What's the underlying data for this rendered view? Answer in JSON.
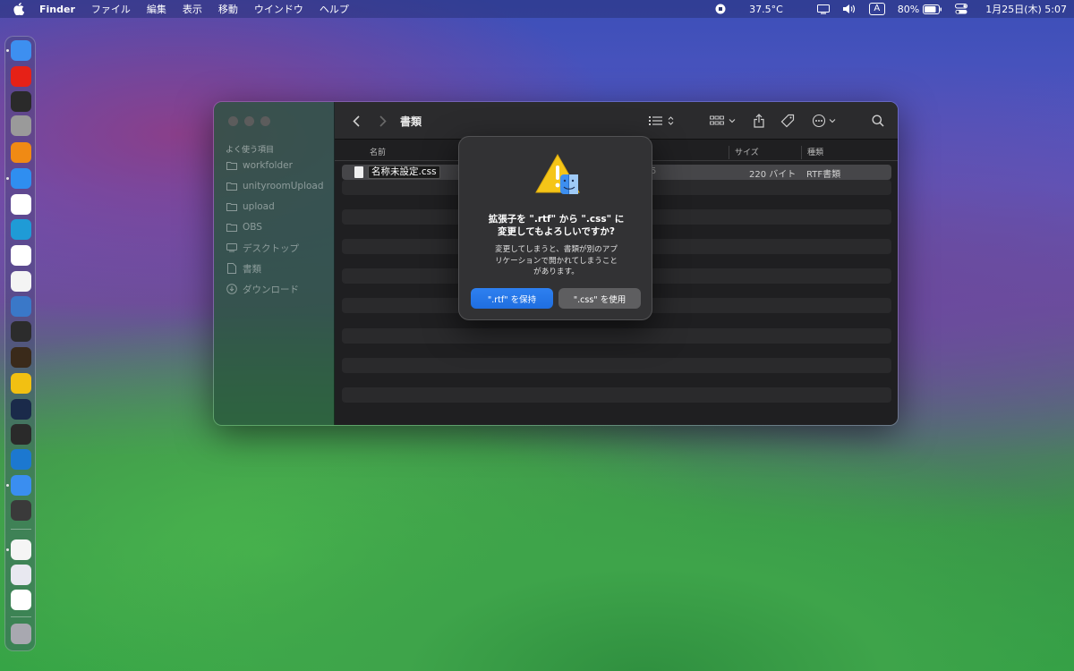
{
  "menubar": {
    "app_name": "Finder",
    "items": [
      "ファイル",
      "編集",
      "表示",
      "移動",
      "ウインドウ",
      "ヘルプ"
    ],
    "temperature": "37.5°C",
    "ime": "A",
    "battery": "80%",
    "datetime": "1月25日(木) 5:07"
  },
  "dock": {
    "apps": [
      {
        "name": "finder-icon",
        "color": "#3d8ff0"
      },
      {
        "name": "youtube-icon",
        "color": "#e62117"
      },
      {
        "name": "obs-icon",
        "color": "#2a2a2a"
      },
      {
        "name": "webcam-icon",
        "color": "#9a9a9a"
      },
      {
        "name": "vlc-icon",
        "color": "#f08a14"
      },
      {
        "name": "safari-icon",
        "color": "#2f8ef0"
      },
      {
        "name": "chrome-icon",
        "color": "#ffffff"
      },
      {
        "name": "edge-icon",
        "color": "#1f9bd6"
      },
      {
        "name": "activity-monitor-icon",
        "color": "#ffffff"
      },
      {
        "name": "textedit-icon",
        "color": "#f4f4f4"
      },
      {
        "name": "quicktime-icon",
        "color": "#3a78c8"
      },
      {
        "name": "final-cut-icon",
        "color": "#2c2c2c"
      },
      {
        "name": "garageband-icon",
        "color": "#3a2a1a"
      },
      {
        "name": "vectorworks-icon",
        "color": "#f2c012"
      },
      {
        "name": "blender-icon",
        "color": "#1a2a4a"
      },
      {
        "name": "unity-icon",
        "color": "#2a2a2a"
      },
      {
        "name": "vscode-icon",
        "color": "#1c78d0"
      },
      {
        "name": "xcode-icon",
        "color": "#3a8ef0"
      },
      {
        "name": "calculator-icon",
        "color": "#3a3a3a"
      },
      {
        "name": "notes-icon",
        "color": "#f5f5f5"
      },
      {
        "name": "preview-icon",
        "color": "#e8e8f0"
      },
      {
        "name": "photos-icon",
        "color": "#ffffff"
      },
      {
        "name": "trash-icon",
        "color": "#a8a8b0"
      }
    ]
  },
  "finder": {
    "title": "書類",
    "sidebar": {
      "section_header": "よく使う項目",
      "items": [
        {
          "label": "workfolder",
          "icon": "folder-icon"
        },
        {
          "label": "unityroomUpload",
          "icon": "folder-icon"
        },
        {
          "label": "upload",
          "icon": "folder-icon"
        },
        {
          "label": "OBS",
          "icon": "folder-icon"
        },
        {
          "label": "デスクトップ",
          "icon": "desktop-icon"
        },
        {
          "label": "書類",
          "icon": "document-icon"
        },
        {
          "label": "ダウンロード",
          "icon": "download-icon"
        }
      ]
    },
    "columns": {
      "name": "名前",
      "size": "サイズ",
      "kind": "種類"
    },
    "files": [
      {
        "name": "名称未設定.css",
        "date_fragment": "5",
        "size": "220 バイト",
        "kind": "RTF書類"
      }
    ]
  },
  "alert": {
    "title": "拡張子を \".rtf\" から \".css\" に\n変更してもよろしいですか?",
    "message": "変更してしまうと、書類が別のアプ\nリケーションで開かれてしまうこと\nがあります。",
    "keep_button": "\".rtf\" を保持",
    "use_button": "\".css\" を使用"
  }
}
